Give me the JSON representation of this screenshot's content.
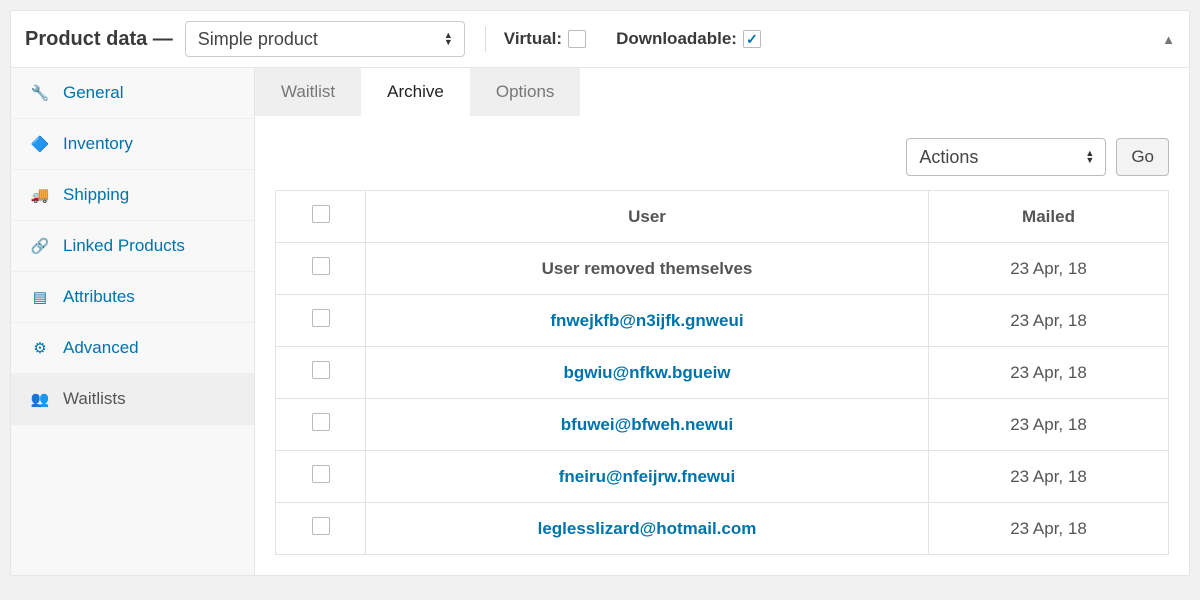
{
  "header": {
    "title": "Product data —",
    "product_type": "Simple product",
    "virtual_label": "Virtual:",
    "virtual_checked": false,
    "downloadable_label": "Downloadable:",
    "downloadable_checked": true
  },
  "sidebar": {
    "items": [
      {
        "label": "General",
        "icon": "wrench-icon",
        "glyph": "🔧"
      },
      {
        "label": "Inventory",
        "icon": "tag-icon",
        "glyph": "🔷"
      },
      {
        "label": "Shipping",
        "icon": "truck-icon",
        "glyph": "🚚"
      },
      {
        "label": "Linked Products",
        "icon": "link-icon",
        "glyph": "🔗"
      },
      {
        "label": "Attributes",
        "icon": "list-icon",
        "glyph": "▤"
      },
      {
        "label": "Advanced",
        "icon": "gear-icon",
        "glyph": "⚙"
      },
      {
        "label": "Waitlists",
        "icon": "users-icon",
        "glyph": "👥"
      }
    ],
    "active_index": 6
  },
  "tabs": {
    "items": [
      "Waitlist",
      "Archive",
      "Options"
    ],
    "active_index": 1
  },
  "actions": {
    "selected": "Actions",
    "go_label": "Go"
  },
  "table": {
    "columns": {
      "user": "User",
      "mailed": "Mailed"
    },
    "rows": [
      {
        "user": "User removed themselves",
        "is_link": false,
        "mailed": "23 Apr, 18"
      },
      {
        "user": "fnwejkfb@n3ijfk.gnweui",
        "is_link": true,
        "mailed": "23 Apr, 18"
      },
      {
        "user": "bgwiu@nfkw.bgueiw",
        "is_link": true,
        "mailed": "23 Apr, 18"
      },
      {
        "user": "bfuwei@bfweh.newui",
        "is_link": true,
        "mailed": "23 Apr, 18"
      },
      {
        "user": "fneiru@nfeijrw.fnewui",
        "is_link": true,
        "mailed": "23 Apr, 18"
      },
      {
        "user": "leglesslizard@hotmail.com",
        "is_link": true,
        "mailed": "23 Apr, 18"
      }
    ]
  }
}
